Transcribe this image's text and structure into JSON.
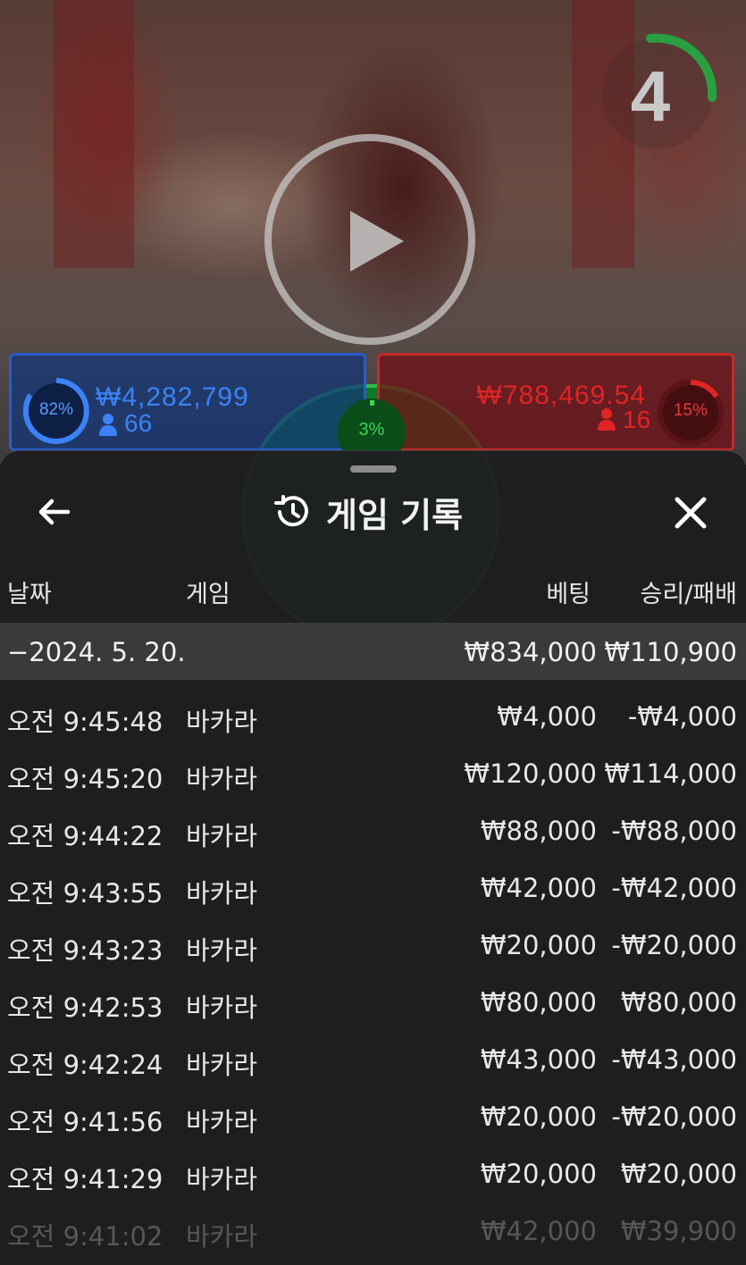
{
  "video": {
    "countdown": "4",
    "play_icon": "play-icon"
  },
  "bets": {
    "player": {
      "percent": "82%",
      "amount": "₩4,282,799",
      "count": "66",
      "color": "#3b82f6"
    },
    "tie": {
      "percent": "3%",
      "color": "#2fbf4a"
    },
    "banker": {
      "percent": "15%",
      "amount": "₩788,469.54",
      "count": "16",
      "color": "#e02424"
    }
  },
  "sheet": {
    "title": "게임 기록",
    "icons": {
      "back": "arrow-left-icon",
      "history": "history-icon",
      "close": "close-icon"
    },
    "columns": {
      "date": "날짜",
      "game": "게임",
      "bet": "베팅",
      "winloss": "승리/패배"
    },
    "date_group": {
      "label": "−2024. 5. 20.",
      "bet_total": "₩834,000",
      "winloss_total": "₩110,900"
    },
    "rows": [
      {
        "time": "오전 9:45:48",
        "game": "바카라",
        "bet": "₩4,000",
        "winloss": "-₩4,000"
      },
      {
        "time": "오전 9:45:20",
        "game": "바카라",
        "bet": "₩120,000",
        "winloss": "₩114,000"
      },
      {
        "time": "오전 9:44:22",
        "game": "바카라",
        "bet": "₩88,000",
        "winloss": "-₩88,000"
      },
      {
        "time": "오전 9:43:55",
        "game": "바카라",
        "bet": "₩42,000",
        "winloss": "-₩42,000"
      },
      {
        "time": "오전 9:43:23",
        "game": "바카라",
        "bet": "₩20,000",
        "winloss": "-₩20,000"
      },
      {
        "time": "오전 9:42:53",
        "game": "바카라",
        "bet": "₩80,000",
        "winloss": "₩80,000"
      },
      {
        "time": "오전 9:42:24",
        "game": "바카라",
        "bet": "₩43,000",
        "winloss": "-₩43,000"
      },
      {
        "time": "오전 9:41:56",
        "game": "바카라",
        "bet": "₩20,000",
        "winloss": "-₩20,000"
      },
      {
        "time": "오전 9:41:29",
        "game": "바카라",
        "bet": "₩20,000",
        "winloss": "₩20,000"
      },
      {
        "time": "오전 9:41:02",
        "game": "바카라",
        "bet": "₩42,000",
        "winloss": "₩39,900"
      }
    ]
  }
}
